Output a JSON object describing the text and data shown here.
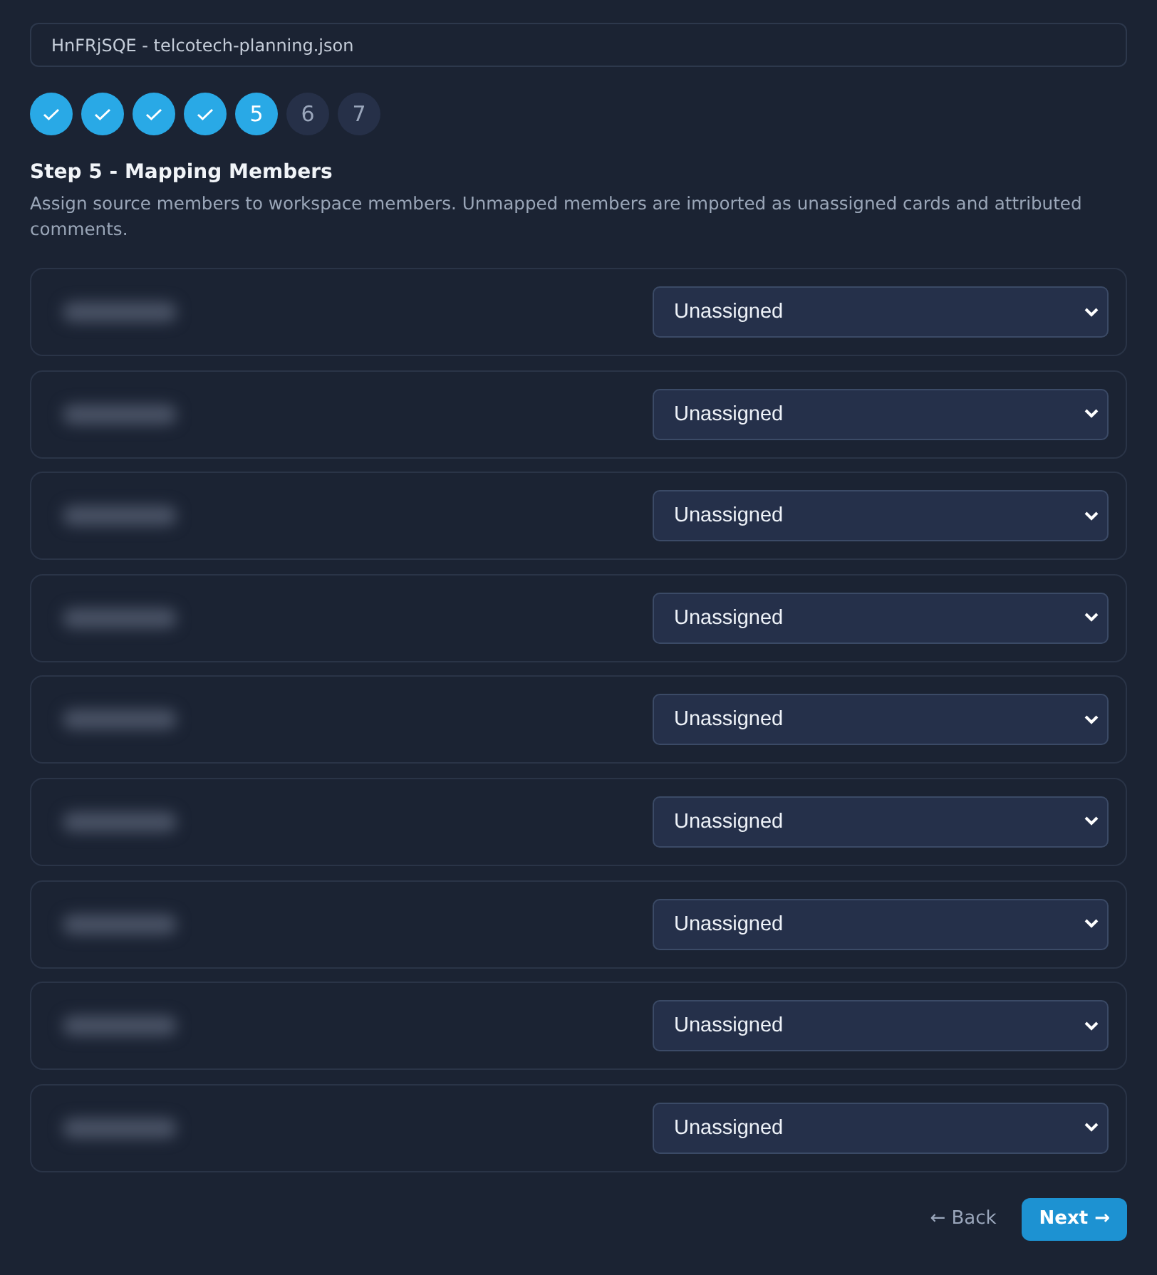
{
  "source_file": {
    "value": "HnFRjSQE - telcotech-planning.json"
  },
  "steps": [
    {
      "done": true,
      "current": false
    },
    {
      "done": true,
      "current": false
    },
    {
      "done": true,
      "current": false
    },
    {
      "done": true,
      "current": false
    },
    {
      "label": "5",
      "done": false,
      "current": true
    },
    {
      "label": "6",
      "done": false,
      "current": false
    },
    {
      "label": "7",
      "done": false,
      "current": false
    }
  ],
  "step_title": "Step 5 - Mapping Members",
  "step_description": "Assign source members to workspace members. Unmapped members are imported as unassigned cards and attributed comments.",
  "members": [
    {
      "assignee": "Unassigned"
    },
    {
      "assignee": "Unassigned"
    },
    {
      "assignee": "Unassigned"
    },
    {
      "assignee": "Unassigned"
    },
    {
      "assignee": "Unassigned"
    },
    {
      "assignee": "Unassigned"
    },
    {
      "assignee": "Unassigned"
    },
    {
      "assignee": "Unassigned"
    },
    {
      "assignee": "Unassigned"
    }
  ],
  "buttons": {
    "back": "← Back",
    "next": "Next →"
  }
}
